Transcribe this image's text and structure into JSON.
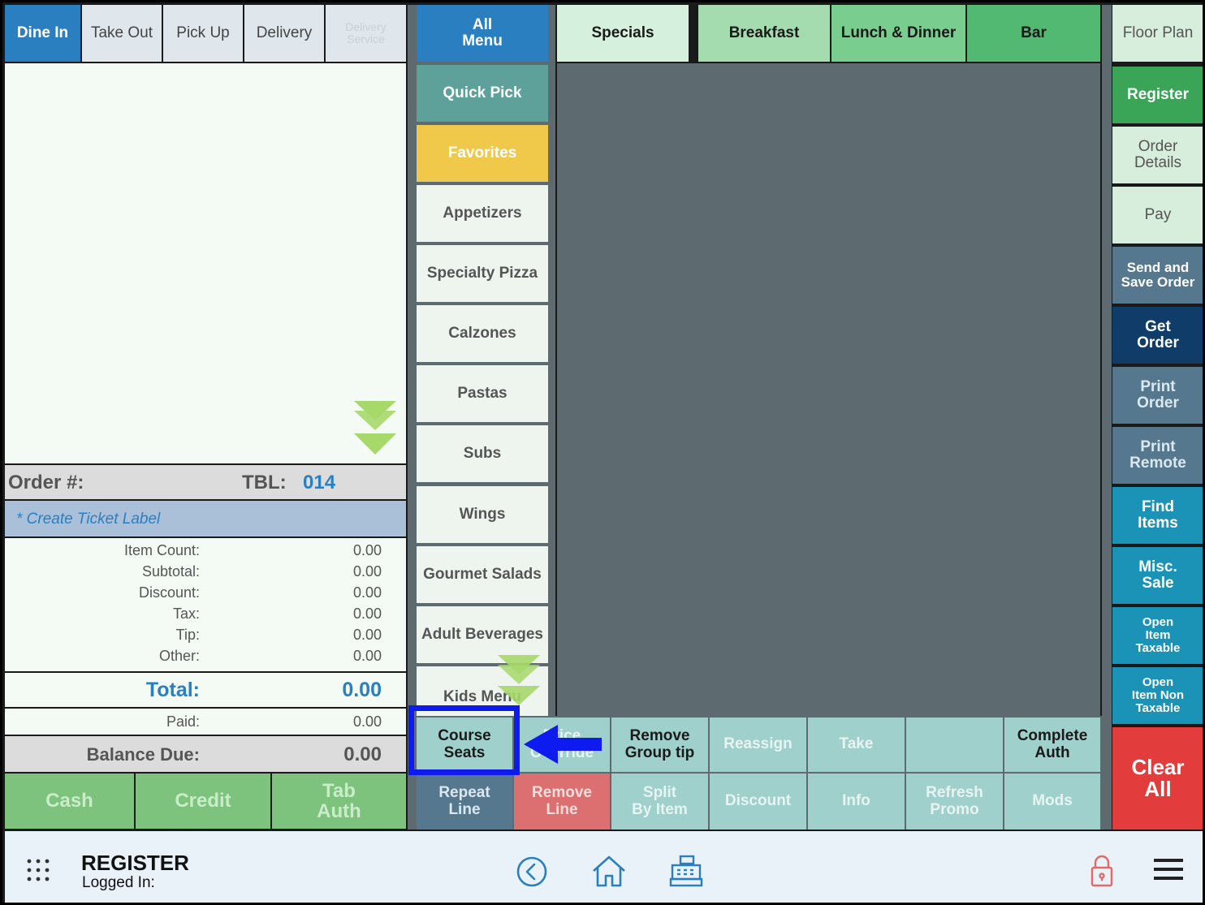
{
  "order_types": [
    {
      "label": "Dine In",
      "active": true
    },
    {
      "label": "Take Out"
    },
    {
      "label": "Pick Up"
    },
    {
      "label": "Delivery"
    },
    {
      "label": "Delivery\nService",
      "disabled": true
    }
  ],
  "menu_categories": {
    "all_menu": "All\nMenu",
    "top": [
      "Specials",
      "Breakfast",
      "Lunch & Dinner",
      "Bar"
    ],
    "side": [
      "Quick Pick",
      "Favorites",
      "Appetizers",
      "Specialty Pizza",
      "Calzones",
      "Pastas",
      "Subs",
      "Wings",
      "Gourmet Salads",
      "Adult Beverages",
      "Kids Menu"
    ]
  },
  "order_summary": {
    "order_label": "Order #:",
    "table_label": "TBL:",
    "table_number": "014",
    "ticket_label": "* Create Ticket Label",
    "rows": [
      {
        "label": "Item Count:",
        "value": "0.00"
      },
      {
        "label": "Subtotal:",
        "value": "0.00"
      },
      {
        "label": "Discount:",
        "value": "0.00"
      },
      {
        "label": "Tax:",
        "value": "0.00"
      },
      {
        "label": "Tip:",
        "value": "0.00"
      },
      {
        "label": "Other:",
        "value": "0.00"
      }
    ],
    "total_label": "Total:",
    "total_value": "0.00",
    "paid_label": "Paid:",
    "paid_value": "0.00",
    "balance_label": "Balance Due:",
    "balance_value": "0.00"
  },
  "payment_buttons": [
    "Cash",
    "Credit",
    "Tab\nAuth"
  ],
  "action_buttons_row1": [
    "Course\nSeats",
    "Price\nOverride",
    "Remove\nGroup tip",
    "Reassign",
    "Take",
    "",
    "Complete\nAuth"
  ],
  "action_buttons_row2": [
    "Repeat\nLine",
    "Remove\nLine",
    "Split\nBy Item",
    "Discount",
    "Info",
    "Refresh\nPromo",
    "Mods"
  ],
  "right_panel": [
    "Floor Plan",
    "Register",
    "Order\nDetails",
    "Pay",
    "Send and\nSave Order",
    "Get\nOrder",
    "Print\nOrder",
    "Print\nRemote",
    "Find\nItems",
    "Misc.\nSale",
    "Open\nItem\nTaxable",
    "Open\nItem Non\nTaxable"
  ],
  "clear_all": "Clear\nAll",
  "footer": {
    "title": "REGISTER",
    "subtitle": "Logged In:"
  },
  "icons": [
    "apps-grid-icon",
    "back-circle-icon",
    "home-icon",
    "cash-register-icon",
    "lock-icon",
    "hamburger-menu-icon",
    "double-chevron-down-icon",
    "left-arrow-icon"
  ],
  "colors": {
    "highlight": "#0d1bf0",
    "accent_blue": "#2a7fc0",
    "clear_red": "#e23c3c"
  }
}
